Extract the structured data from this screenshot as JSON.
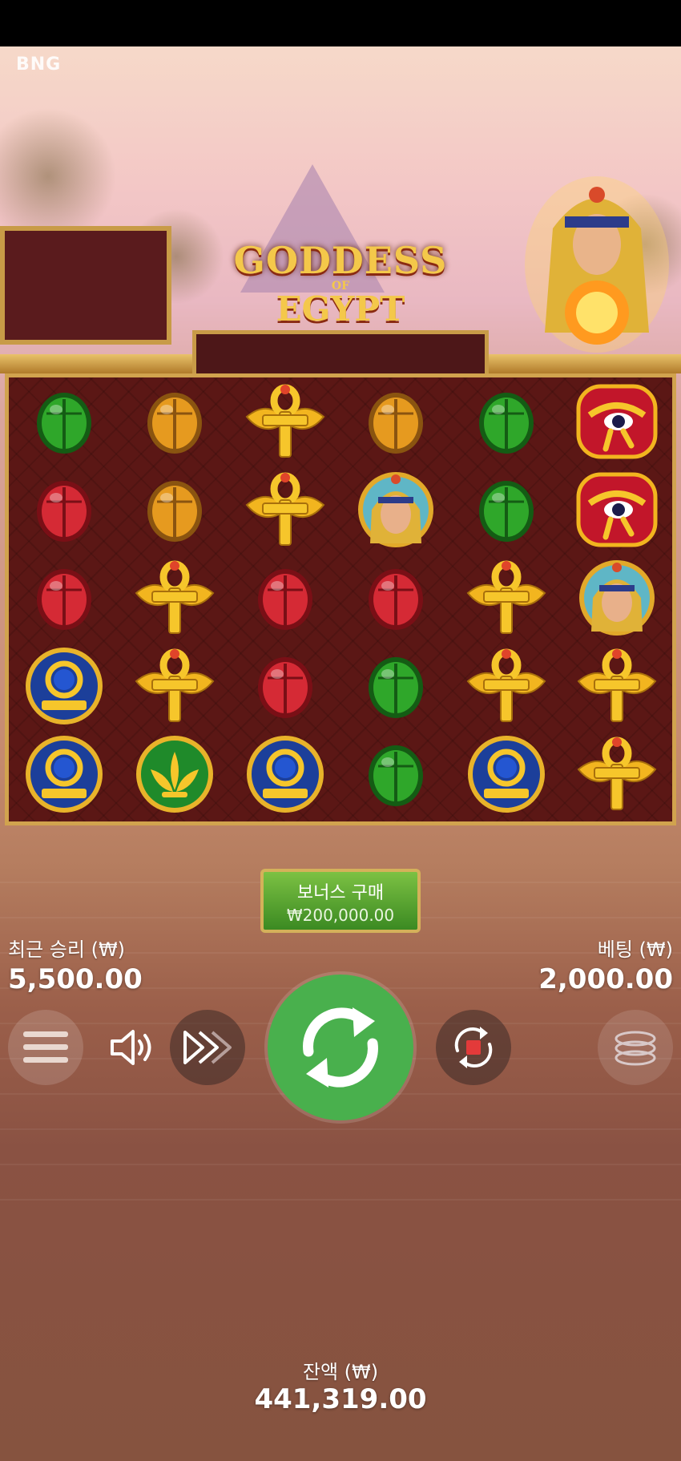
{
  "game": {
    "provider": "BNG",
    "title": {
      "line1": "GODDESS",
      "line2": "OF",
      "line3": "EGYPT"
    }
  },
  "bonus_buy": {
    "label": "보너스 구매",
    "price": "₩200,000.00"
  },
  "last_win": {
    "label": "최근 승리 (₩)",
    "value": "5,500.00"
  },
  "bet": {
    "label": "베팅 (₩)",
    "value": "2,000.00"
  },
  "balance": {
    "label": "잔액 (₩)",
    "value": "441,319.00"
  },
  "controls": {
    "menu": "menu-icon",
    "sound": "speaker-icon",
    "turbo": "fast-forward-icon",
    "spin": "spin-icon",
    "autoplay": "autoplay-stop-icon",
    "bet_chips": "coin-stack-icon"
  },
  "reels": [
    [
      "green-scarab",
      "orange-scarab",
      "gold-ankh",
      "orange-scarab",
      "green-scarab",
      "eye-of-horus"
    ],
    [
      "red-scarab",
      "orange-scarab",
      "gold-ankh",
      "cleopatra",
      "green-scarab",
      "eye-of-horus"
    ],
    [
      "red-scarab",
      "gold-ankh",
      "red-scarab",
      "red-scarab",
      "gold-ankh",
      "cleopatra"
    ],
    [
      "blue-omega",
      "gold-ankh",
      "red-scarab",
      "green-scarab",
      "gold-ankh",
      "gold-ankh"
    ],
    [
      "blue-omega",
      "lotus",
      "blue-omega",
      "green-scarab",
      "blue-omega",
      "gold-ankh"
    ]
  ],
  "colors": {
    "spin": "#49b04d",
    "frame": "#d1a34e",
    "grid_bg": "#5b1715"
  }
}
